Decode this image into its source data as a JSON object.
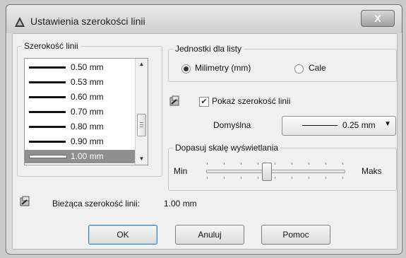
{
  "window": {
    "title": "Ustawienia szerokości linii",
    "close_label": "X"
  },
  "lineweights": {
    "legend": "Szerokość linii",
    "items": [
      "0.50 mm",
      "0.53 mm",
      "0.60 mm",
      "0.70 mm",
      "0.80 mm",
      "0.90 mm",
      "1.00 mm"
    ],
    "selected": "1.00 mm"
  },
  "units": {
    "legend": "Jednostki dla listy",
    "millimeters_label": "Milimetry (mm)",
    "inches_label": "Cale",
    "selected": "Milimetry (mm)"
  },
  "display": {
    "show_lineweight_label": "Pokaż szerokość linii",
    "show_lineweight_checked": true,
    "default_label": "Domyślna",
    "default_value": "0.25 mm"
  },
  "scale": {
    "legend": "Dopasuj skalę wyświetlania",
    "min_label": "Min",
    "max_label": "Maks",
    "level": 0.45
  },
  "current": {
    "label": "Bieżąca szerokość linii:",
    "value": "1.00 mm"
  },
  "buttons": {
    "ok": "OK",
    "cancel": "Anuluj",
    "help": "Pomoc"
  },
  "icons": {
    "app": "autocad-triangle-icon",
    "sysvar": "sysvar-setting-icon"
  }
}
